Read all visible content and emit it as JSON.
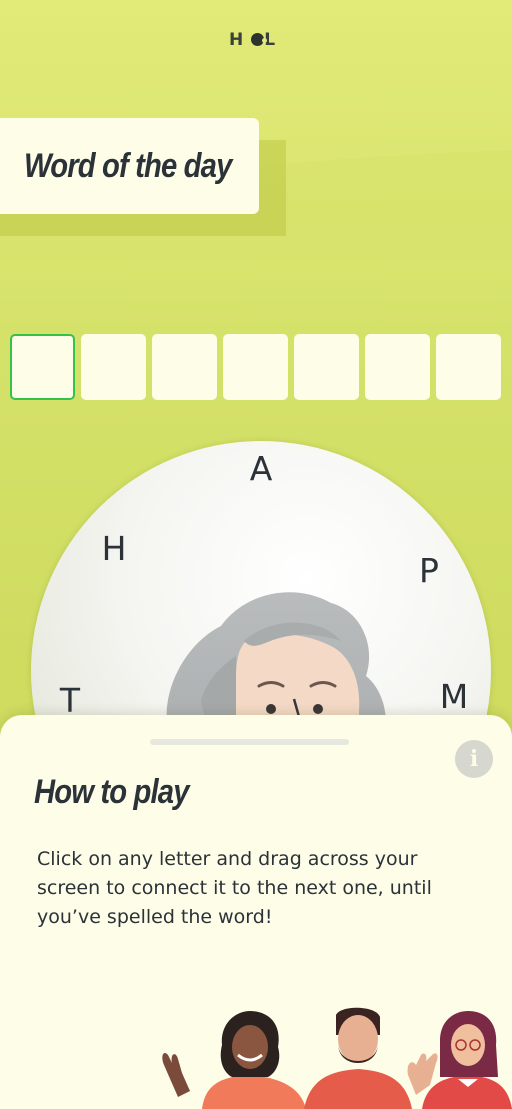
{
  "header": {
    "logo_left": "H",
    "logo_right": "L"
  },
  "title": "Word of the day",
  "word_slots": [
    {
      "letter": "",
      "active": true
    },
    {
      "letter": "",
      "active": false
    },
    {
      "letter": "",
      "active": false
    },
    {
      "letter": "",
      "active": false
    },
    {
      "letter": "",
      "active": false
    },
    {
      "letter": "",
      "active": false
    },
    {
      "letter": "",
      "active": false
    }
  ],
  "wheel": {
    "letters": [
      "A",
      "H",
      "P",
      "T",
      "M"
    ]
  },
  "sheet": {
    "info_icon": "i",
    "title": "How to play",
    "text": "Click on any letter and drag across your screen to connect it to the next one, until you’ve spelled the word!"
  },
  "colors": {
    "background": "#d9e46c",
    "card": "#fdfde8",
    "active_slot_border": "#36c24a",
    "text": "#2b3238"
  }
}
